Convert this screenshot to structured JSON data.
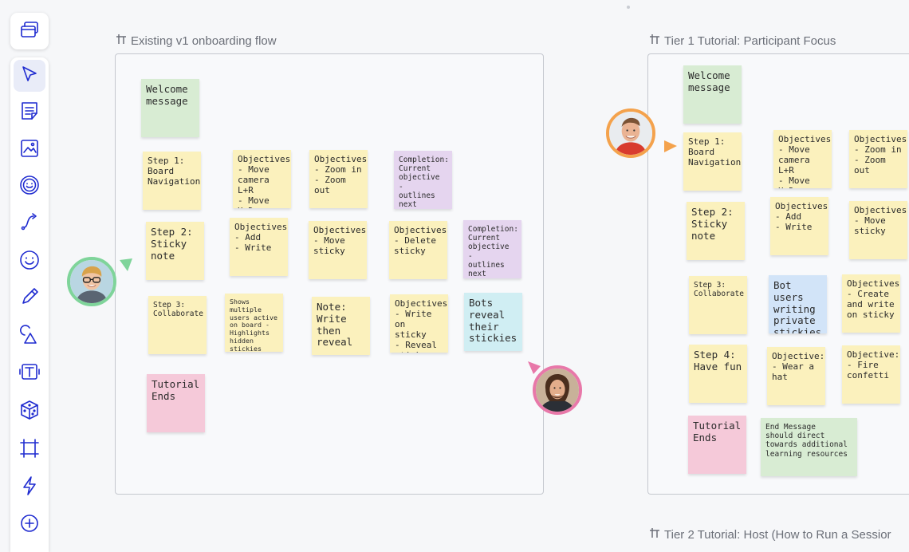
{
  "frames": {
    "v1": {
      "title": "Existing v1 onboarding flow"
    },
    "tier1": {
      "title": "Tier 1 Tutorial: Participant Focus"
    },
    "tier2": {
      "title": "Tier 2 Tutorial: Host (How to Run a Sessior"
    }
  },
  "stickies_v1": {
    "welcome": "Welcome\nmessage",
    "step1": "Step 1:\nBoard\nNavigation",
    "obj_move": "Objectives:\n- Move\ncamera L+R\n- Move U+D",
    "obj_zoom": "Objectives:\n- Zoom in\n- Zoom out",
    "completion1": "Completion:\nCurrent\nobjective -\noutlines next\nobjective",
    "step2": "Step 2:\nSticky\nnote",
    "obj_add": "Objectives:\n- Add\n- Write",
    "obj_movesticky": "Objectives:\n- Move\nsticky",
    "obj_delete": "Objectives:\n- Delete\nsticky",
    "completion2": "Completion:\nCurrent\nobjective -\noutlines next\nobjective",
    "step3": "Step 3:\nCollaborate",
    "shows": "Shows multiple\nusers active\non board -\nHighlights\nhidden stickies",
    "note": "Note:\nWrite\nthen\nreveal",
    "obj_write": "Objectives:\n- Write on\nsticky\n- Reveal\nsticky",
    "bots": "Bots\nreveal\ntheir\nstickies",
    "ends": "Tutorial\nEnds"
  },
  "stickies_t1": {
    "welcome": "Welcome\nmessage",
    "step1": "Step 1:\nBoard\nNavigation",
    "obj_move": "Objectives:\n- Move\ncamera L+R\n- Move U+D",
    "obj_zoom": "Objectives:\n- Zoom in\n- Zoom out",
    "step2": "Step 2:\nSticky\nnote",
    "obj_add": "Objectives:\n- Add\n- Write",
    "obj_movesticky": "Objectives:\n- Move\nsticky",
    "step3": "Step 3:\nCollaborate",
    "bots": "Bot users\nwriting\nprivate\nstickies",
    "obj_create": "Objectives:\n- Create\nand write\non sticky",
    "step4": "Step 4:\nHave fun",
    "obj_hat": "Objective:\n- Wear a\nhat",
    "obj_confetti": "Objective:\n- Fire\nconfetti",
    "ends": "Tutorial\nEnds",
    "end_msg": "End Message\nshould direct\ntowards additional\nlearning resources"
  },
  "toolbar": {
    "tools": [
      "layers-icon",
      "select-icon",
      "sticky-note-icon",
      "image-icon",
      "sticker-icon",
      "connector-icon",
      "emoji-icon",
      "pen-icon",
      "shapes-icon",
      "text-icon",
      "dice-icon",
      "frame-icon",
      "lightning-icon",
      "add-icon"
    ],
    "active": "select-icon"
  },
  "colors": {
    "accent": "#1f2bd0",
    "cursor_green": "#7fd49a",
    "cursor_orange": "#f4a24c",
    "cursor_pink": "#e878a9"
  }
}
